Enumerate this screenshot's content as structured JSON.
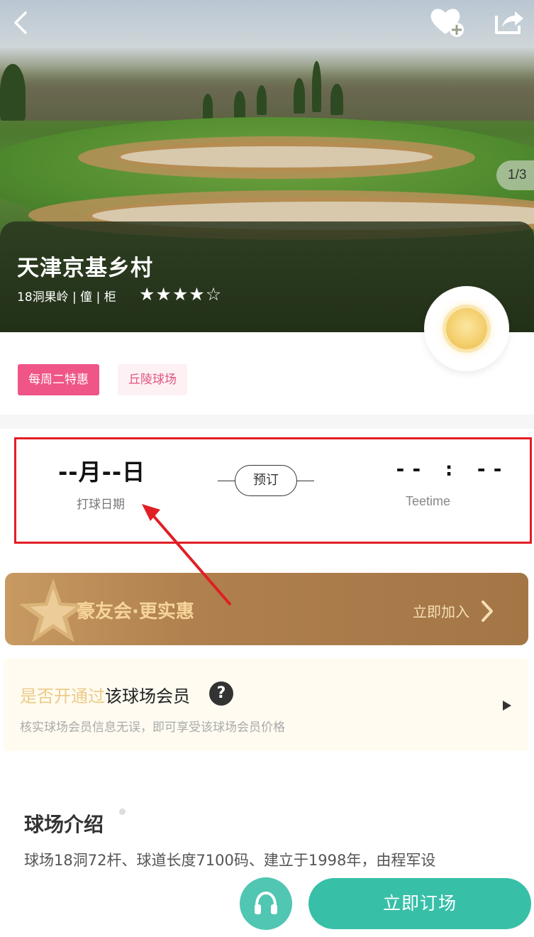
{
  "hero": {
    "image_counter": "1/3",
    "course_name": "天津京基乡村",
    "course_sub": "18洞果岭 | 僮 | 柜",
    "rating_stars": 4,
    "rating_max": 5
  },
  "tags": [
    "每周二特惠",
    "丘陵球场"
  ],
  "booking": {
    "date_value": "--月--日",
    "date_label": "打球日期",
    "book_button": "预订",
    "time_value": "-- : --",
    "time_label": "Teetime"
  },
  "club": {
    "title": "豪友会·更实惠",
    "join_label": "立即加入"
  },
  "member": {
    "title_highlight": "是否开通过",
    "title_rest": "该球场会员",
    "help_glyph": "?",
    "subtitle": "核实球场会员信息无误，即可享受该球场会员价格"
  },
  "intro": {
    "title": "球场介绍",
    "text": "球场18洞72杆、球道长度7100码、建立于1998年，由程军设"
  },
  "footer": {
    "book_now": "立即订场"
  },
  "colors": {
    "highlight_box": "#e11e24",
    "tag_primary": "#ef5587",
    "book_now": "#38bfa8",
    "service": "#51c6b2",
    "club_gold": "#f6d49a"
  },
  "icons": [
    "back-icon",
    "favorite-add-icon",
    "share-icon",
    "sun-icon",
    "star-icon",
    "help-icon",
    "chevron-right-icon",
    "play-icon",
    "headset-icon"
  ]
}
